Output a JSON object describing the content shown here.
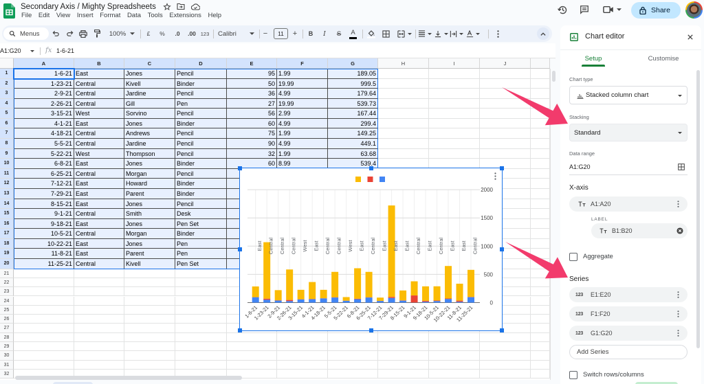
{
  "app": {
    "title": "Secondary Axis / Mighty Spreadsheets",
    "menu": [
      "File",
      "Edit",
      "View",
      "Insert",
      "Format",
      "Data",
      "Tools",
      "Extensions",
      "Help"
    ],
    "share_label": "Share"
  },
  "toolbar": {
    "search_placeholder": "Menus",
    "zoom": "100%",
    "currency": "£",
    "percent": "%",
    "decrease_decimal": ".0",
    "increase_decimal": ".00",
    "more_formats": "123",
    "font": "Calibri",
    "font_size": "11",
    "minus": "−",
    "plus": "+",
    "bold": "B",
    "italic": "I",
    "strikethrough": "S",
    "text_color": "A"
  },
  "formula_bar": {
    "name_box": "A1:G20",
    "fx": "fx",
    "value": "1-6-21"
  },
  "sheet": {
    "columns": [
      "A",
      "B",
      "C",
      "D",
      "E",
      "F",
      "G",
      "H",
      "I",
      "J"
    ],
    "row_headers": [
      "1",
      "2",
      "3",
      "4",
      "5",
      "6",
      "7",
      "8",
      "9",
      "10",
      "11",
      "12",
      "13",
      "14",
      "15",
      "16",
      "17",
      "18",
      "19",
      "20",
      "21",
      "22",
      "23",
      "24",
      "25",
      "26",
      "27",
      "28",
      "29",
      "30",
      "31",
      "32"
    ],
    "selected_range": "A1:G20",
    "rows": [
      [
        "1-6-21",
        "East",
        "Jones",
        "Pencil",
        "95",
        "1.99",
        "189.05"
      ],
      [
        "1-23-21",
        "Central",
        "Kivell",
        "Binder",
        "50",
        "19.99",
        "999.5"
      ],
      [
        "2-9-21",
        "Central",
        "Jardine",
        "Pencil",
        "36",
        "4.99",
        "179.64"
      ],
      [
        "2-26-21",
        "Central",
        "Gill",
        "Pen",
        "27",
        "19.99",
        "539.73"
      ],
      [
        "3-15-21",
        "West",
        "Sorvino",
        "Pencil",
        "56",
        "2.99",
        "167.44"
      ],
      [
        "4-1-21",
        "East",
        "Jones",
        "Binder",
        "60",
        "4.99",
        "299.4"
      ],
      [
        "4-18-21",
        "Central",
        "Andrews",
        "Pencil",
        "75",
        "1.99",
        "149.25"
      ],
      [
        "5-5-21",
        "Central",
        "Jardine",
        "Pencil",
        "90",
        "4.99",
        "449.1"
      ],
      [
        "5-22-21",
        "West",
        "Thompson",
        "Pencil",
        "32",
        "1.99",
        "63.68"
      ],
      [
        "6-8-21",
        "East",
        "Jones",
        "Binder",
        "60",
        "8.99",
        "539.4"
      ],
      [
        "6-25-21",
        "Central",
        "Morgan",
        "Pencil",
        "",
        "",
        ""
      ],
      [
        "7-12-21",
        "East",
        "Howard",
        "Binder",
        "",
        "",
        ""
      ],
      [
        "7-29-21",
        "East",
        "Parent",
        "Binder",
        "",
        "",
        ""
      ],
      [
        "8-15-21",
        "East",
        "Jones",
        "Pencil",
        "",
        "",
        ""
      ],
      [
        "9-1-21",
        "Central",
        "Smith",
        "Desk",
        "",
        "",
        ""
      ],
      [
        "9-18-21",
        "East",
        "Jones",
        "Pen Set",
        "",
        "",
        ""
      ],
      [
        "10-5-21",
        "Central",
        "Morgan",
        "Binder",
        "",
        "",
        ""
      ],
      [
        "10-22-21",
        "East",
        "Jones",
        "Pen",
        "",
        "",
        ""
      ],
      [
        "11-8-21",
        "East",
        "Parent",
        "Pen",
        "",
        "",
        ""
      ],
      [
        "11-25-21",
        "Central",
        "Kivell",
        "Pen Set",
        "",
        "",
        ""
      ]
    ]
  },
  "chart_data": {
    "type": "bar",
    "stacked": true,
    "title": "",
    "xlabel": "",
    "ylabel": "",
    "categories": [
      "1-6-21",
      "1-23-21",
      "2-9-21",
      "2-26-21",
      "3-15-21",
      "4-1-21",
      "4-18-21",
      "5-5-21",
      "5-22-21",
      "6-8-21",
      "6-25-21",
      "7-12-21",
      "7-29-21",
      "8-15-21",
      "9-1-21",
      "9-18-21",
      "10-5-21",
      "10-22-21",
      "11-8-21",
      "11-25-21"
    ],
    "category_labels": [
      "East",
      "Central",
      "Central",
      "Central",
      "West",
      "East",
      "Central",
      "Central",
      "West",
      "East",
      "Central",
      "East",
      "East",
      "East",
      "Central",
      "East",
      "Central",
      "East",
      "East",
      "Central"
    ],
    "series": [
      {
        "name": "",
        "color": "#4285f4",
        "values": [
          95,
          50,
          36,
          27,
          56,
          60,
          75,
          90,
          32,
          60,
          90,
          29,
          81,
          35,
          2,
          16,
          28,
          64,
          15,
          96
        ]
      },
      {
        "name": "",
        "color": "#ea4335",
        "values": [
          1.99,
          19.99,
          4.99,
          19.99,
          2.99,
          4.99,
          1.99,
          4.99,
          1.99,
          8.99,
          4.99,
          1.99,
          19.99,
          4.99,
          125,
          15.99,
          8.99,
          8.99,
          19.99,
          4.99
        ]
      },
      {
        "name": "",
        "color": "#fbbc04",
        "values": [
          189.05,
          999.5,
          179.64,
          539.73,
          167.44,
          299.4,
          149.25,
          449.1,
          63.68,
          539.4,
          449.1,
          57.71,
          1619.19,
          174.65,
          250,
          255.84,
          251.72,
          575.36,
          299.85,
          479.04
        ]
      }
    ],
    "ylim": [
      0,
      2000
    ],
    "yticks": [
      "0",
      "500",
      "1000",
      "1500",
      "2000"
    ],
    "y_axis_side": "right",
    "grid": true,
    "legend": "top"
  },
  "chart_editor": {
    "title": "Chart editor",
    "tabs": [
      {
        "label": "Setup",
        "active": true
      },
      {
        "label": "Customise",
        "active": false
      }
    ],
    "chart_type": {
      "label": "Chart type",
      "value": "Stacked column chart"
    },
    "stacking": {
      "label": "Stacking",
      "value": "Standard"
    },
    "data_range": {
      "label": "Data range",
      "value": "A1:G20"
    },
    "x_axis": {
      "label": "X-axis",
      "range": "A1:A20",
      "label_heading": "LABEL",
      "label_range": "B1:B20"
    },
    "aggregate": {
      "label": "Aggregate",
      "checked": false
    },
    "series": {
      "label": "Series",
      "items": [
        {
          "type_icon": "123",
          "range": "E1:E20"
        },
        {
          "type_icon": "123",
          "range": "F1:F20"
        },
        {
          "type_icon": "123",
          "range": "G1:G20"
        }
      ],
      "add_label": "Add Series"
    },
    "switch_rows_columns": {
      "label": "Switch rows/columns",
      "checked": false
    }
  },
  "colors": {
    "accent": "#1a73e8",
    "editor_green": "#188038",
    "share_bg": "#c2e7ff",
    "selection_bg": "#e8f0fe",
    "annotation_arrow": "#f23b6c"
  }
}
